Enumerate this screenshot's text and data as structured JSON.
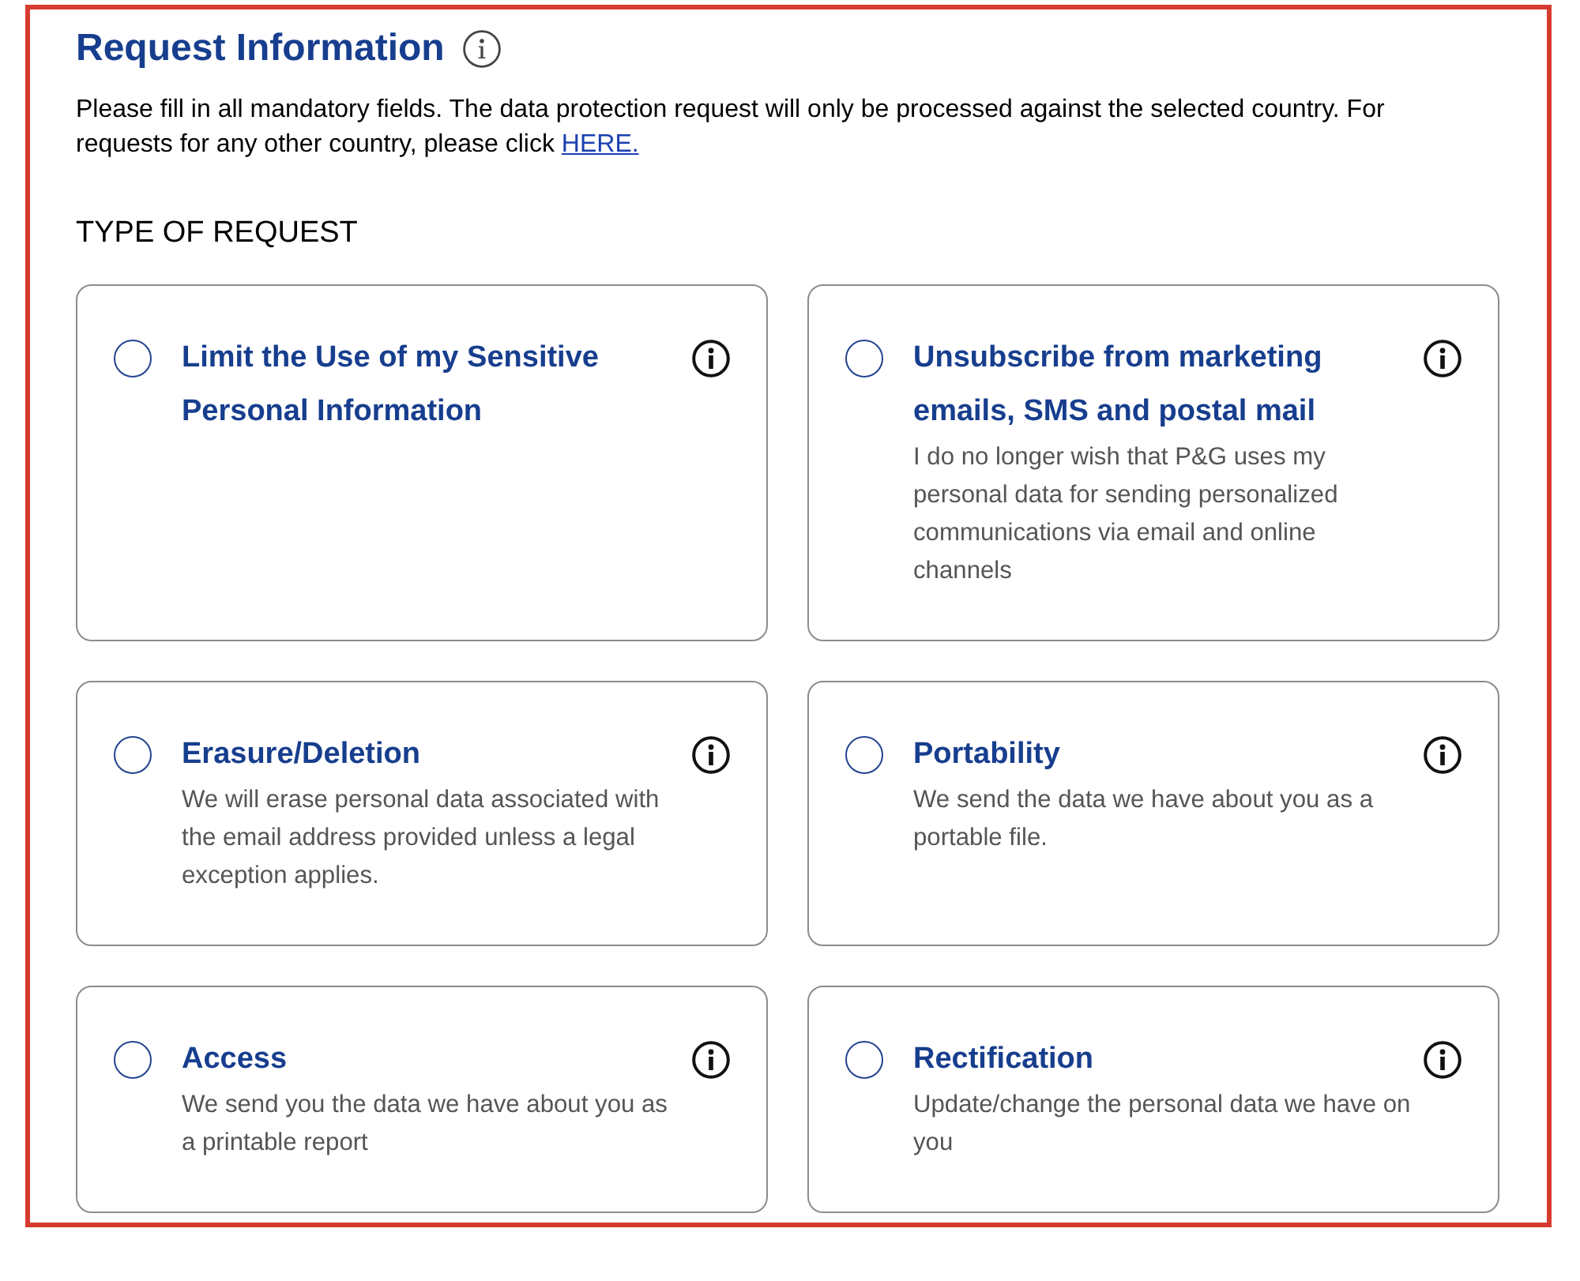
{
  "header": {
    "title": "Request Information"
  },
  "intro": {
    "text": "Please fill in all mandatory fields. The data protection request will only be processed against the selected country. For requests for any other country, please click ",
    "link": "HERE."
  },
  "section_label": "TYPE OF REQUEST",
  "options": [
    {
      "title": "Limit the Use of my Sensitive Personal Information",
      "selected": false
    },
    {
      "title": "Unsubscribe from marketing emails, SMS and postal mail",
      "description": "I do no longer wish that P&G uses my personal data for sending personalized communications via email and online channels",
      "selected": false
    },
    {
      "title": "Erasure/Deletion",
      "description": "We will erase personal data associated with the email address provided unless a legal exception applies.",
      "selected": false
    },
    {
      "title": "Portability",
      "description": "We send the data we have about you as a portable file.",
      "selected": false
    },
    {
      "title": "Access",
      "description": "We send you the data we have about you as a printable report",
      "selected": false
    },
    {
      "title": "Rectification",
      "description": "Update/change the personal data we have on you",
      "selected": false
    }
  ]
}
